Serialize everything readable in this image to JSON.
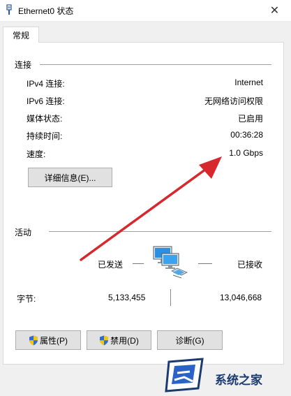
{
  "window": {
    "title": "Ethernet0 状态",
    "close_symbol": "✕"
  },
  "tabs": [
    {
      "label": "常规",
      "active": true
    }
  ],
  "connection": {
    "section_label": "连接",
    "rows": [
      {
        "label": "IPv4 连接:",
        "value": "Internet"
      },
      {
        "label": "IPv6 连接:",
        "value": "无网络访问权限"
      },
      {
        "label": "媒体状态:",
        "value": "已启用"
      },
      {
        "label": "持续时间:",
        "value": "00:36:28"
      },
      {
        "label": "速度:",
        "value": "1.0 Gbps"
      }
    ],
    "details_button": "详细信息(E)..."
  },
  "activity": {
    "section_label": "活动",
    "sent_label": "已发送",
    "received_label": "已接收",
    "bytes_label": "字节:",
    "bytes_sent": "5,133,455",
    "bytes_received": "13,046,668",
    "icon": "network-computers-icon"
  },
  "buttons": {
    "properties": "属性(P)",
    "disable": "禁用(D)",
    "diagnose": "诊断(G)"
  },
  "watermark": {
    "text": "系统之家"
  },
  "colors": {
    "arrow": "#d7282e",
    "watermark": "#1a3a70",
    "shield_blue": "#2a6dd6",
    "shield_yellow": "#f3c614"
  }
}
